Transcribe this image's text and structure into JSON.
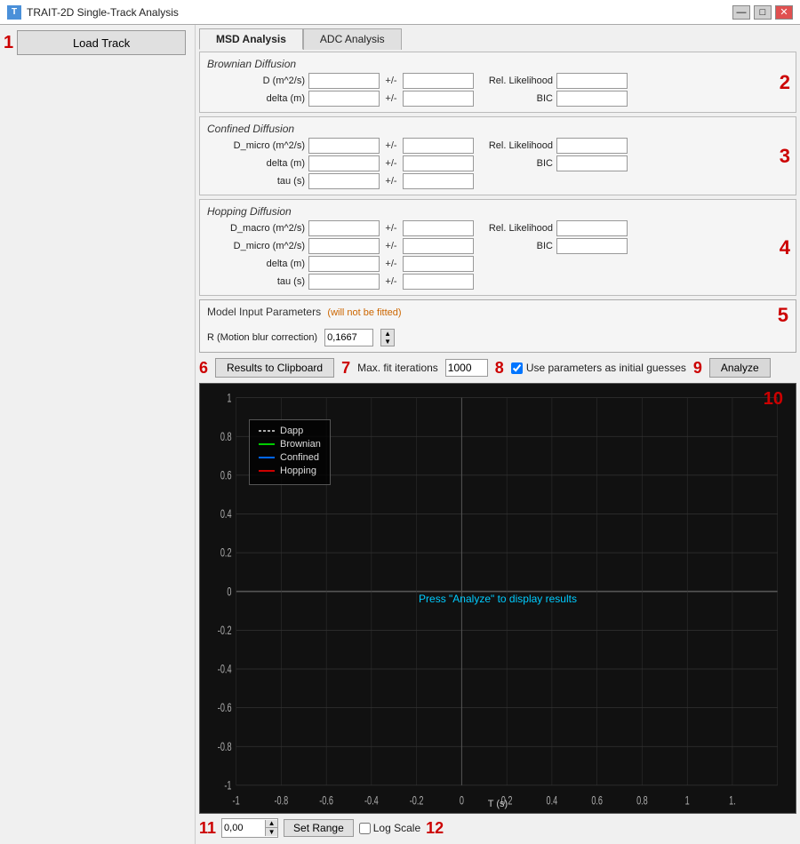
{
  "window": {
    "title": "TRAIT-2D Single-Track Analysis",
    "icon": "T"
  },
  "title_bar_controls": {
    "minimize": "—",
    "maximize": "□",
    "close": "✕"
  },
  "left_panel": {
    "section_number": "1",
    "load_track_label": "Load Track"
  },
  "tabs": [
    {
      "id": "msd",
      "label": "MSD Analysis",
      "active": true
    },
    {
      "id": "adc",
      "label": "ADC Analysis",
      "active": false
    }
  ],
  "sections": {
    "brownian": {
      "number": "2",
      "title": "Brownian Diffusion",
      "rows": [
        {
          "label": "D (m^2/s)",
          "val1": "",
          "val2": "",
          "right_label": "Rel. Likelihood",
          "right_val": ""
        },
        {
          "label": "delta (m)",
          "val1": "",
          "val2": "",
          "right_label": "BIC",
          "right_val": ""
        }
      ]
    },
    "confined": {
      "number": "3",
      "title": "Confined Diffusion",
      "rows": [
        {
          "label": "D_micro (m^2/s)",
          "val1": "",
          "val2": "",
          "right_label": "Rel. Likelihood",
          "right_val": ""
        },
        {
          "label": "delta (m)",
          "val1": "",
          "val2": "",
          "right_label": "BIC",
          "right_val": ""
        },
        {
          "label": "tau (s)",
          "val1": "",
          "val2": "",
          "right_label": "",
          "right_val": ""
        }
      ]
    },
    "hopping": {
      "number": "4",
      "title": "Hopping Diffusion",
      "rows": [
        {
          "label": "D_macro (m^2/s)",
          "val1": "",
          "val2": "",
          "right_label": "Rel. Likelihood",
          "right_val": ""
        },
        {
          "label": "D_micro (m^2/s)",
          "val1": "",
          "val2": "",
          "right_label": "BIC",
          "right_val": ""
        },
        {
          "label": "delta (m)",
          "val1": "",
          "val2": "",
          "right_label": "",
          "right_val": ""
        },
        {
          "label": "tau (s)",
          "val1": "",
          "val2": "",
          "right_label": "",
          "right_val": ""
        }
      ]
    }
  },
  "model_params": {
    "section_number": "5",
    "title": "Model Input Parameters",
    "subtitle": "(will not be fitted)",
    "r_label": "R (Motion blur correction)",
    "r_value": "0,1667"
  },
  "toolbar": {
    "section6": "6",
    "section7": "7",
    "section8": "8",
    "section9": "9",
    "results_label": "Results to Clipboard",
    "max_iter_label": "Max. fit iterations",
    "max_iter_value": "1000",
    "use_params_label": "Use parameters as initial guesses",
    "analyze_label": "Analyze"
  },
  "chart": {
    "section_number": "10",
    "y_label": "Dapp",
    "x_label": "T (s)",
    "press_analyze_text": "Press \"Analyze\" to display results",
    "y_ticks": [
      "1",
      "0.8",
      "0.6",
      "0.4",
      "0.2",
      "0",
      "-0.2",
      "-0.4",
      "-0.6",
      "-0.8",
      "-1"
    ],
    "x_ticks": [
      "-1",
      "-0.8",
      "-0.6",
      "-0.4",
      "-0.2",
      "0",
      "0.2",
      "0.4",
      "0.6",
      "0.8",
      "1",
      "1."
    ],
    "legend": [
      {
        "label": "Dapp",
        "color": "#aaaaaa",
        "style": "dashed"
      },
      {
        "label": "Brownian",
        "color": "#00cc00",
        "style": "solid"
      },
      {
        "label": "Confined",
        "color": "#0066ff",
        "style": "solid"
      },
      {
        "label": "Hopping",
        "color": "#cc0000",
        "style": "solid"
      }
    ]
  },
  "bottom": {
    "section11": "11",
    "range_value": "0,00",
    "set_range_label": "Set Range",
    "log_scale_label": "Log Scale",
    "section12": "12"
  }
}
